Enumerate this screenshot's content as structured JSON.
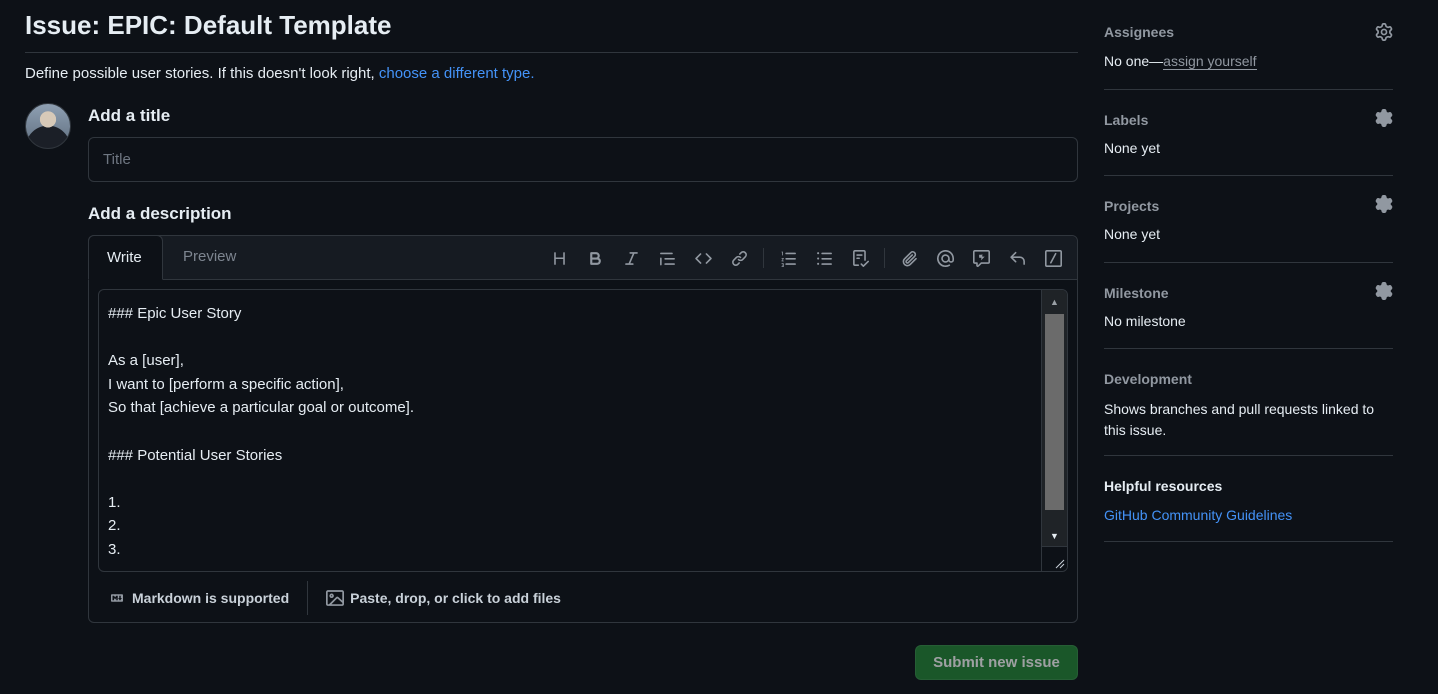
{
  "header": {
    "title": "Issue: EPIC: Default Template",
    "subtitle_text": "Define possible user stories. If this doesn't look right, ",
    "subtitle_link": "choose a different type."
  },
  "form": {
    "title_label": "Add a title",
    "title_placeholder": "Title",
    "description_label": "Add a description",
    "tabs": {
      "write": "Write",
      "preview": "Preview"
    },
    "toolbar_icons": [
      "heading-icon",
      "bold-icon",
      "italic-icon",
      "quote-icon",
      "code-icon",
      "link-icon",
      "ordered-list-icon",
      "unordered-list-icon",
      "task-list-icon",
      "attach-icon",
      "mention-icon",
      "reference-icon",
      "reply-icon",
      "slash-command-icon"
    ],
    "description_text": "### Epic User Story\n\nAs a [user],\nI want to [perform a specific action],\nSo that [achieve a particular goal or outcome].\n\n### Potential User Stories\n\n1.\n2.\n3.",
    "footer": {
      "markdown": "Markdown is supported",
      "files": "Paste, drop, or click to add files"
    },
    "submit_label": "Submit new issue"
  },
  "sidebar": {
    "assignees": {
      "title": "Assignees",
      "value": "No one—",
      "link": "assign yourself"
    },
    "labels": {
      "title": "Labels",
      "value": "None yet"
    },
    "projects": {
      "title": "Projects",
      "value": "None yet"
    },
    "milestone": {
      "title": "Milestone",
      "value": "No milestone"
    },
    "development": {
      "title": "Development",
      "value": "Shows branches and pull requests linked to this issue."
    },
    "helpful": {
      "title": "Helpful resources",
      "link": "GitHub Community Guidelines"
    }
  },
  "colors": {
    "background": "#0d1117",
    "border": "#30363d",
    "link": "#4493f8",
    "submit": "#238636"
  }
}
